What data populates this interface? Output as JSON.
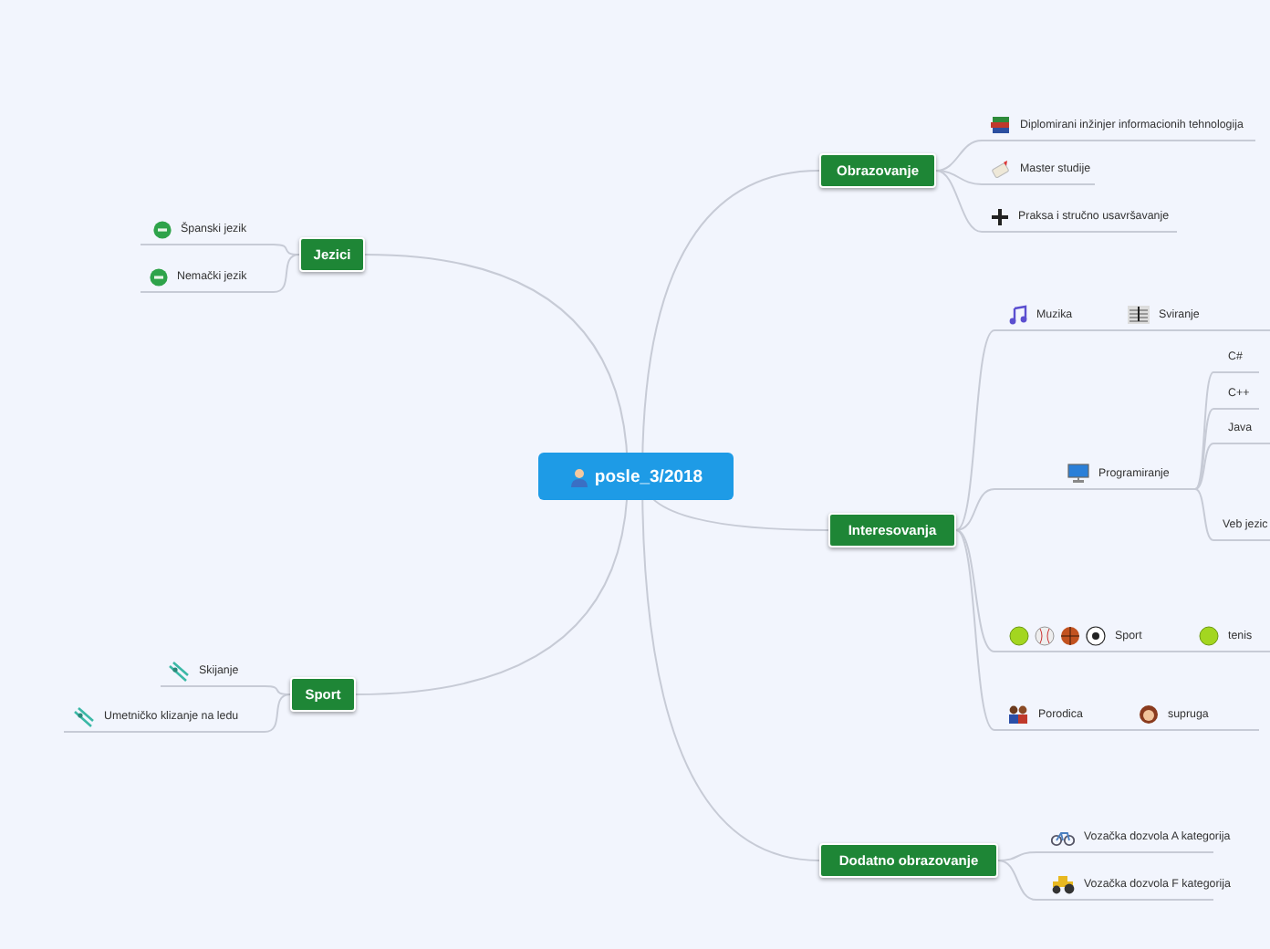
{
  "root": {
    "title": "posle_3/2018"
  },
  "branches": [
    {
      "label": "Obrazovanje",
      "children": [
        {
          "label": "Diplomirani inžinjer informacionih tehnologija"
        },
        {
          "label": "Master studije"
        },
        {
          "label": "Praksa i stručno usavršavanje"
        }
      ]
    },
    {
      "label": "Interesovanja",
      "children": [
        {
          "label": "Muzika",
          "children": [
            {
              "label": "Sviranje"
            }
          ]
        },
        {
          "label": "Programiranje",
          "children": [
            {
              "label": "C#"
            },
            {
              "label": "C++"
            },
            {
              "label": "Java"
            },
            {
              "label": "Veb jezic"
            }
          ]
        },
        {
          "label": "Sport",
          "children": [
            {
              "label": "tenis"
            }
          ]
        },
        {
          "label": "Porodica",
          "children": [
            {
              "label": "supruga"
            }
          ]
        }
      ]
    },
    {
      "label": "Dodatno obrazovanje",
      "children": [
        {
          "label": "Vozačka dozvola A kategorija"
        },
        {
          "label": "Vozačka dozvola F kategorija"
        }
      ]
    },
    {
      "label": "Jezici",
      "children": [
        {
          "label": "Španski jezik"
        },
        {
          "label": "Nemački jezik"
        }
      ]
    },
    {
      "label": "Sport",
      "children": [
        {
          "label": "Skijanje"
        },
        {
          "label": "Umetničko klizanje na ledu"
        }
      ]
    }
  ]
}
